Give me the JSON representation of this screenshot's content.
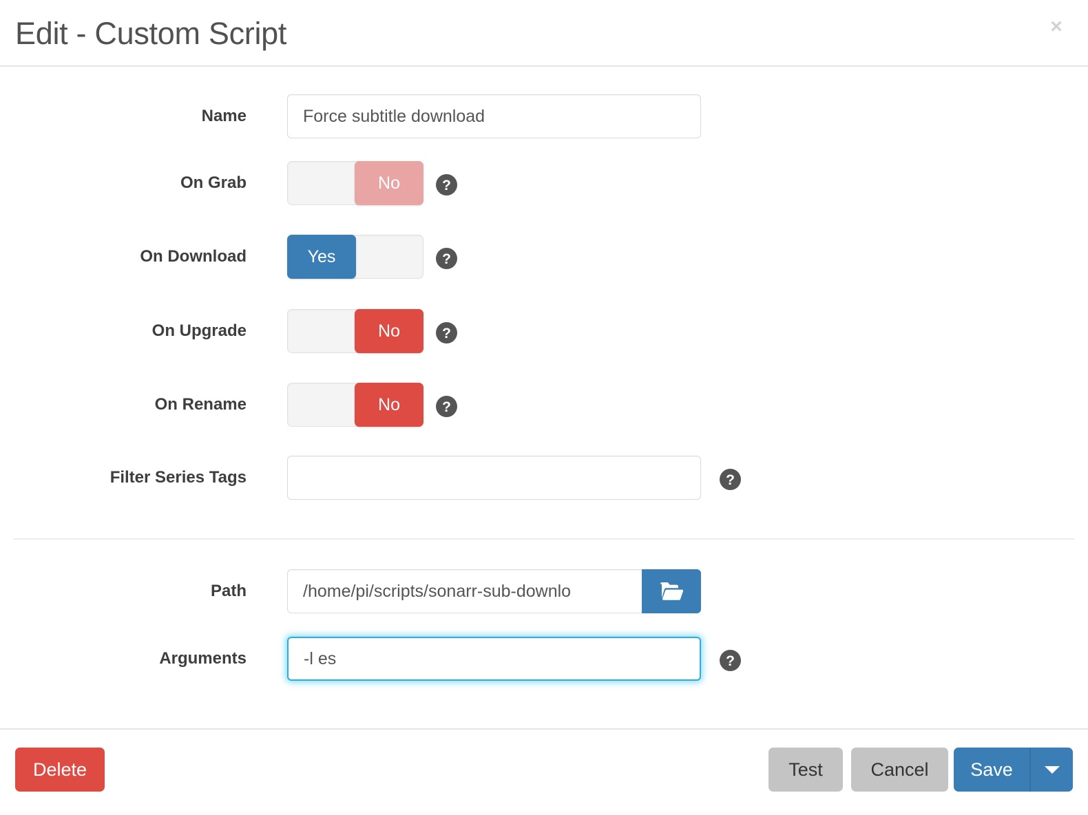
{
  "header": {
    "title": "Edit - Custom Script",
    "close_label": "×"
  },
  "form": {
    "fields": [
      {
        "label": "Name",
        "type": "text",
        "value": "Force subtitle download",
        "placeholder": "",
        "help": false
      },
      {
        "label": "On Grab",
        "type": "toggle",
        "value": "No",
        "state": "off-muted",
        "help": true
      },
      {
        "label": "On Download",
        "type": "toggle",
        "value": "Yes",
        "state": "on",
        "help": true
      },
      {
        "label": "On Upgrade",
        "type": "toggle",
        "value": "No",
        "state": "off",
        "help": true
      },
      {
        "label": "On Rename",
        "type": "toggle",
        "value": "No",
        "state": "off",
        "help": true
      },
      {
        "label": "Filter Series Tags",
        "type": "text",
        "value": "",
        "placeholder": "",
        "help": true
      },
      {
        "label": "Path",
        "type": "path",
        "value": "/home/pi/scripts/sonarr-sub-downlo",
        "placeholder": "",
        "help": false
      },
      {
        "label": "Arguments",
        "type": "text",
        "value": "-l es",
        "placeholder": "",
        "help": true,
        "focused": true
      }
    ]
  },
  "icons": {
    "help": "question-mark-circle-icon",
    "folder": "open-folder-icon",
    "close": "close-icon",
    "caret": "caret-down-icon"
  },
  "footer": {
    "delete_label": "Delete",
    "test_label": "Test",
    "cancel_label": "Cancel",
    "save_label": "Save"
  },
  "colors": {
    "primary": "#3a7eb5",
    "danger": "#dd4b43",
    "danger_muted": "#e8a5a3",
    "neutral": "#c4c4c4",
    "focus_glow": "#2aade3",
    "border": "#dadada",
    "divider": "#e5e5e5"
  }
}
